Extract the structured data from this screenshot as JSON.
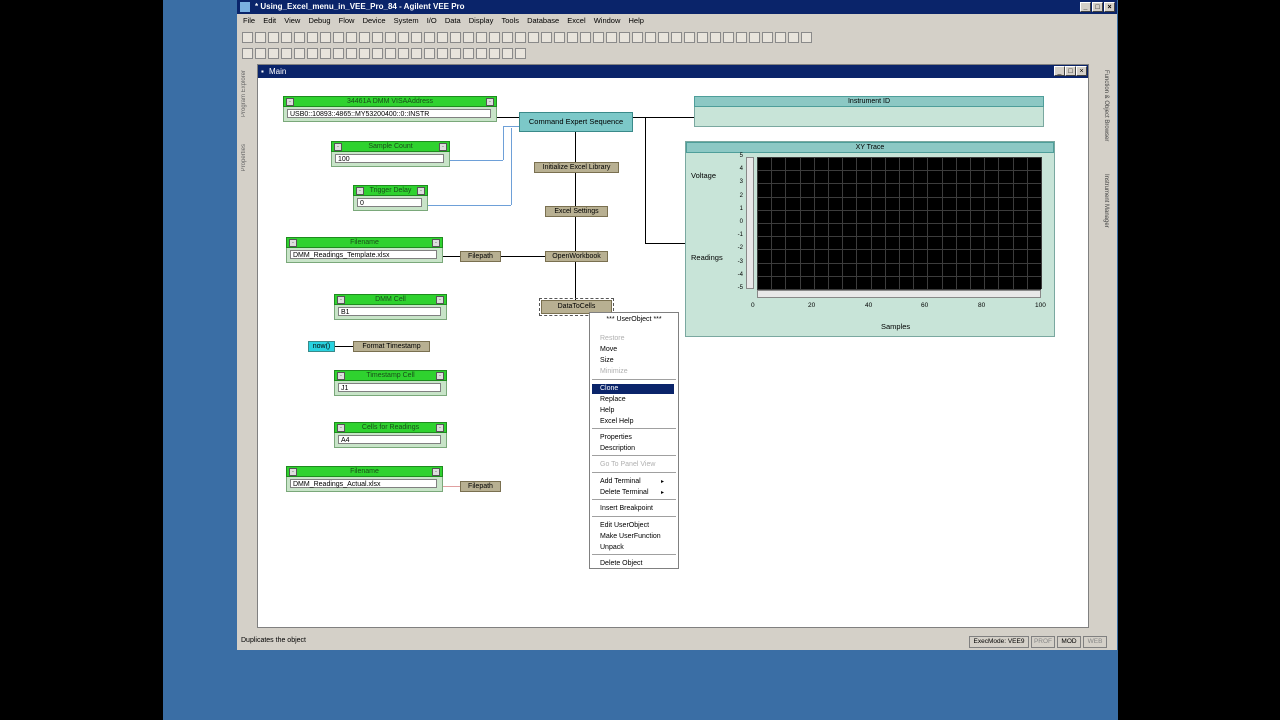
{
  "window": {
    "title": "* Using_Excel_menu_in_VEE_Pro_84 - Agilent VEE Pro"
  },
  "menu": [
    "File",
    "Edit",
    "View",
    "Debug",
    "Flow",
    "Device",
    "System",
    "I/O",
    "Data",
    "Display",
    "Tools",
    "Database",
    "Excel",
    "Window",
    "Help"
  ],
  "side_panels": {
    "left_top": "Program Explorer",
    "left_bottom": "Properties",
    "right_top": "Function & Object Browser",
    "right_bottom": "Instrument Manager"
  },
  "main_window": {
    "title": "Main"
  },
  "objects": {
    "visa_address": {
      "title": "34461A DMM VISAAddress",
      "value": "USB0::10893::4865::MY53200400::0::INSTR"
    },
    "sample_count": {
      "title": "Sample Count",
      "value": "100"
    },
    "trigger_delay": {
      "title": "Trigger Delay",
      "value": "0"
    },
    "filename_template": {
      "title": "Filename",
      "value": "DMM_Readings_Template.xlsx"
    },
    "dmm_cell": {
      "title": "DMM Cell",
      "value": "B1"
    },
    "timestamp_cell": {
      "title": "Timestamp Cell",
      "value": "J1"
    },
    "cells_for_readings": {
      "title": "Cells for Readings",
      "value": "A4"
    },
    "filename_actual": {
      "title": "Filename",
      "value": "DMM_Readings_Actual.xlsx"
    },
    "filepath1": "Filepath",
    "filepath2": "Filepath",
    "now": "now()",
    "format_timestamp": "Format Timestamp",
    "command_expert": "Command Expert Sequence",
    "init_excel": "Initialize Excel Library",
    "excel_settings": "Excel Settings",
    "open_workbook": "OpenWorkbook",
    "data_to_cells": "DataToCells",
    "instrument_id": {
      "title": "Instrument ID"
    },
    "xy_trace": {
      "title": "XY Trace",
      "in_voltage": "Voltage",
      "in_readings": "Readings"
    }
  },
  "chart_data": {
    "type": "line",
    "title": "XY Trace",
    "xlabel": "Samples",
    "ylabel": "",
    "xlim": [
      0,
      100
    ],
    "ylim": [
      -5,
      5
    ],
    "x_ticks": [
      "0",
      "20",
      "40",
      "60",
      "80",
      "100"
    ],
    "y_ticks": [
      "5",
      "4",
      "3",
      "2",
      "1",
      "0",
      "-1",
      "-2",
      "-3",
      "-4",
      "-5"
    ],
    "grid": true,
    "series": []
  },
  "context_menu": {
    "header": "*** UserObject ***",
    "items": [
      {
        "label": "Restore",
        "enabled": false
      },
      {
        "label": "Move",
        "enabled": true
      },
      {
        "label": "Size",
        "enabled": true
      },
      {
        "label": "Minimize",
        "enabled": false
      },
      {
        "label": "Clone",
        "enabled": true,
        "selected": true
      },
      {
        "label": "Replace",
        "enabled": true
      },
      {
        "label": "Help",
        "enabled": true
      },
      {
        "label": "Excel Help",
        "enabled": true
      },
      {
        "label": "Properties",
        "enabled": true
      },
      {
        "label": "Description",
        "enabled": true
      },
      {
        "label": "Go To Panel View",
        "enabled": false
      },
      {
        "label": "Add Terminal",
        "enabled": true,
        "submenu": true
      },
      {
        "label": "Delete Terminal",
        "enabled": true,
        "submenu": true
      },
      {
        "label": "Insert Breakpoint",
        "enabled": true
      },
      {
        "label": "Edit UserObject",
        "enabled": true
      },
      {
        "label": "Make UserFunction",
        "enabled": true
      },
      {
        "label": "Unpack",
        "enabled": true
      },
      {
        "label": "Delete Object",
        "enabled": true
      }
    ]
  },
  "status": {
    "message": "Duplicates the object",
    "exec_mode": "ExecMode: VEE9",
    "prof": "PROF",
    "mod": "MOD",
    "web": "WEB"
  },
  "colors": {
    "title_bar": "#0a246a",
    "desktop": "#3a6ea5",
    "constant_header": "#2fd22f",
    "formula_object": "#b8b092",
    "selection": "#0a246a"
  }
}
